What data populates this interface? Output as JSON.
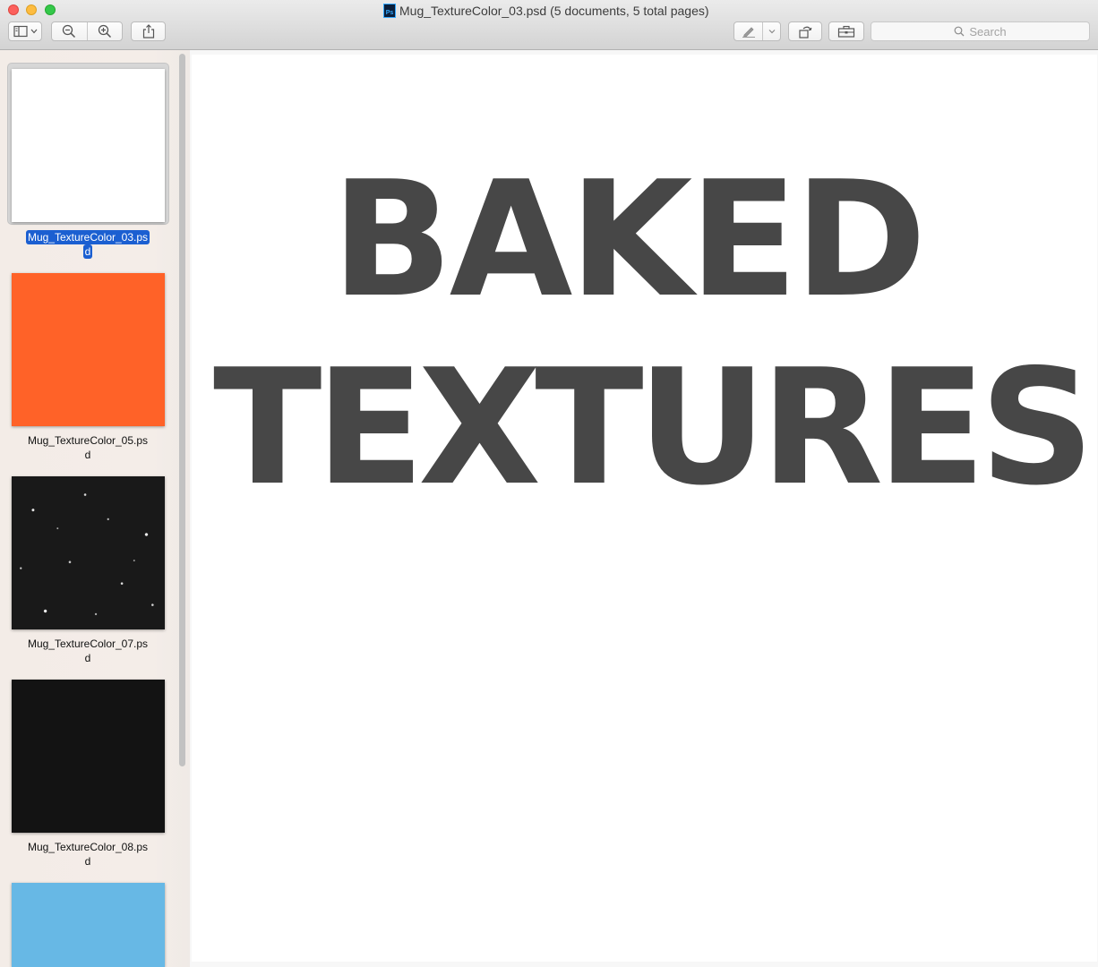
{
  "window": {
    "title": "Mug_TextureColor_03.psd (5 documents, 5 total pages)",
    "file_icon": "photoshop-file-icon"
  },
  "toolbar": {
    "sidebar_button_icon": "sidebar-icon",
    "zoom_out_icon": "zoom-out-icon",
    "zoom_in_icon": "zoom-in-icon",
    "share_icon": "share-icon",
    "markup_icon": "pen-icon",
    "rotate_icon": "rotate-icon",
    "toolbox_icon": "toolbox-icon",
    "search_placeholder": "Search"
  },
  "sidebar": {
    "items": [
      {
        "caption_line1": "Mug_TextureColor_03.ps",
        "caption_line2": "d",
        "color": "#ffffff",
        "selected": true
      },
      {
        "caption_line1": "Mug_TextureColor_05.ps",
        "caption_line2": "d",
        "color": "#ff6228",
        "selected": false
      },
      {
        "caption_line1": "Mug_TextureColor_07.ps",
        "caption_line2": "d",
        "color": "#191919",
        "selected": false
      },
      {
        "caption_line1": "Mug_TextureColor_08.ps",
        "caption_line2": "d",
        "color": "#131313",
        "selected": false
      },
      {
        "caption_line1": "",
        "caption_line2": "",
        "color": "#67b8e5",
        "selected": false
      }
    ]
  },
  "document": {
    "line1": "BAKED",
    "line2": "TEXTURES",
    "text_color": "#474747"
  },
  "colors": {
    "selection": "#1b5fd1",
    "close": "#fc605c",
    "minimize": "#fdbc40",
    "maximize": "#34c84a"
  }
}
